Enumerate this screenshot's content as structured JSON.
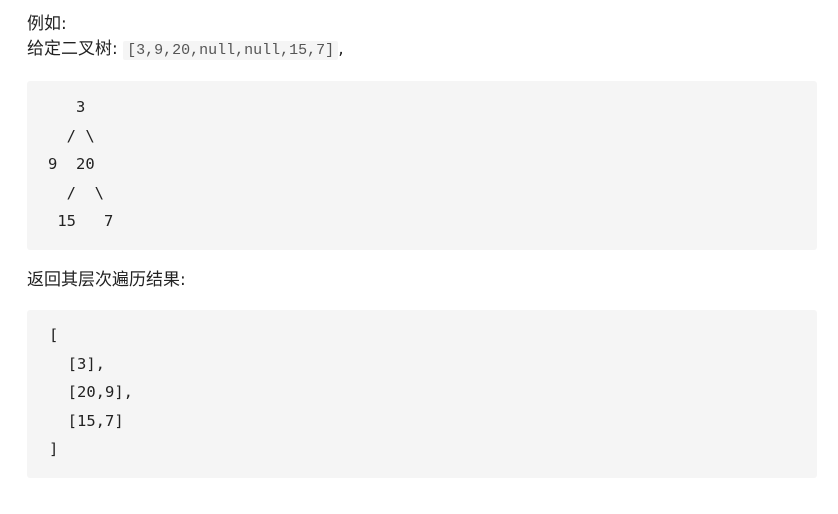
{
  "intro": {
    "example_label": "例如:",
    "given_label": "给定二叉树: ",
    "given_value": "[3,9,20,null,null,15,7]",
    "given_suffix": ","
  },
  "tree_block": {
    "lines": [
      "   3",
      "  / \\",
      "9  20",
      "  /  \\",
      " 15   7"
    ]
  },
  "result_heading": "返回其层次遍历结果:",
  "result_block": {
    "lines": [
      "[",
      "  [3],",
      "  [20,9],",
      "  [15,7]",
      "]"
    ]
  }
}
